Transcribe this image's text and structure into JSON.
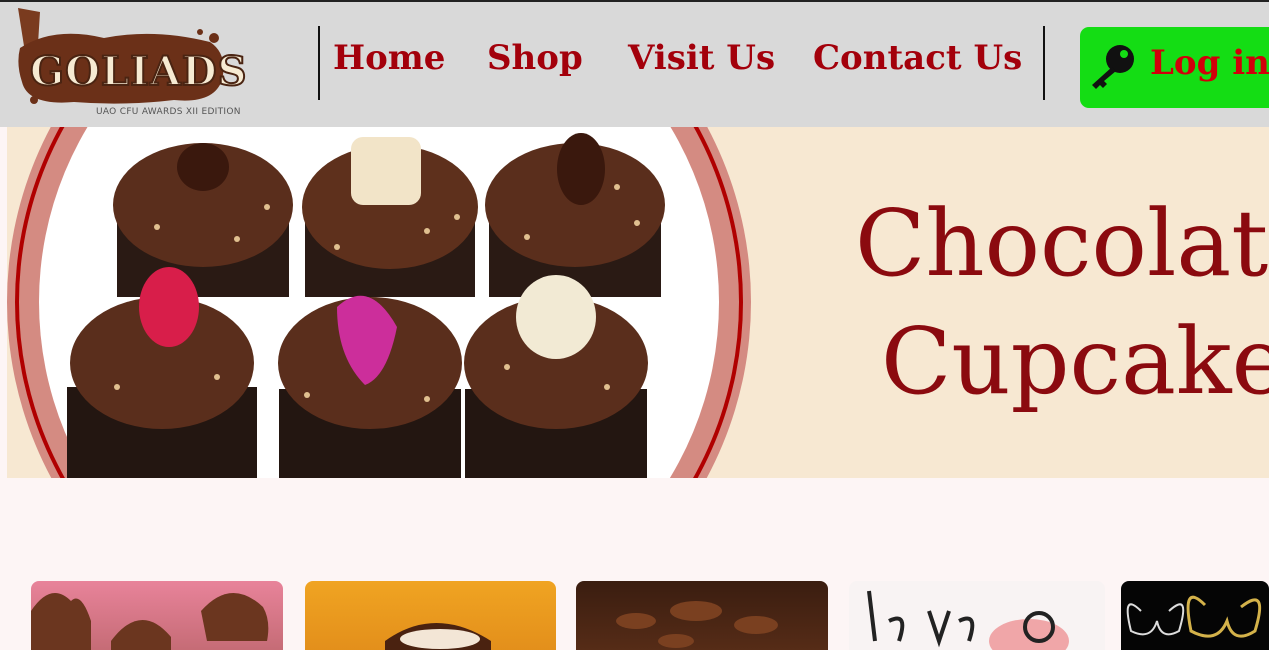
{
  "logo": {
    "word": "GOLIADS",
    "subtitle": "UAO CFU AWARDS XII EDITION"
  },
  "nav": {
    "items": [
      {
        "label": "Home"
      },
      {
        "label": "Shop"
      },
      {
        "label": "Visit Us"
      },
      {
        "label": "Contact Us"
      }
    ],
    "login_label": "Log in"
  },
  "hero": {
    "title_line1": "Chocolate",
    "title_line2": "Cupcakes"
  },
  "colors": {
    "accent": "#a3000b",
    "login_bg": "#14dd14",
    "header_bg": "#d9d9d9",
    "hero_bg": "#f7e8d2"
  },
  "cards": [
    {
      "theme": "pink-chocolate-cupcakes"
    },
    {
      "theme": "orange-chocolate-drizzle"
    },
    {
      "theme": "chocolate-curls"
    },
    {
      "theme": "love-pink-cupcakes"
    },
    {
      "theme": "butterfly-black"
    }
  ]
}
